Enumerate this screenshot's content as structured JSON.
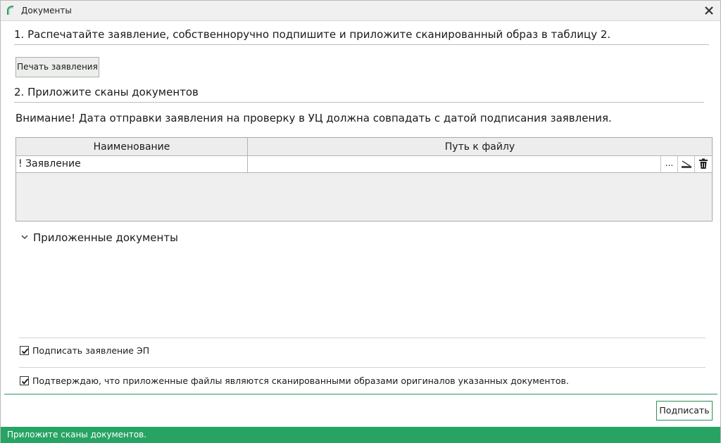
{
  "window": {
    "title": "Документы",
    "close_glyph": "✕"
  },
  "step1": {
    "text": "1. Распечатайте заявление, собственноручно подпишите и приложите сканированный образ в таблицу 2.",
    "print_button": "Печать заявления"
  },
  "step2": {
    "text": "2. Приложите сканы документов",
    "warning": "Внимание! Дата отправки заявления на проверку в УЦ должна совпадать с датой подписания заявления."
  },
  "table": {
    "columns": [
      "Наименование",
      "Путь к файлу"
    ],
    "rows": [
      {
        "name": "! Заявление",
        "path": ""
      }
    ],
    "row_actions": {
      "browse_label": "...",
      "scan_icon": "scanner-icon",
      "delete_icon": "trash-icon"
    }
  },
  "attached_section": {
    "label": "Приложенные документы",
    "chevron_icon": "chevron-down-icon"
  },
  "checkboxes": [
    {
      "label": "Подписать заявление ЭП",
      "checked": true
    },
    {
      "label": "Подтверждаю, что приложенные файлы являются сканированными образами оригиналов указанных документов.",
      "checked": true
    }
  ],
  "footer": {
    "sign_button": "Подписать"
  },
  "status": {
    "text": "Приложите сканы документов."
  },
  "colors": {
    "accent_green": "#27a464",
    "border_green": "#2f8f57"
  }
}
